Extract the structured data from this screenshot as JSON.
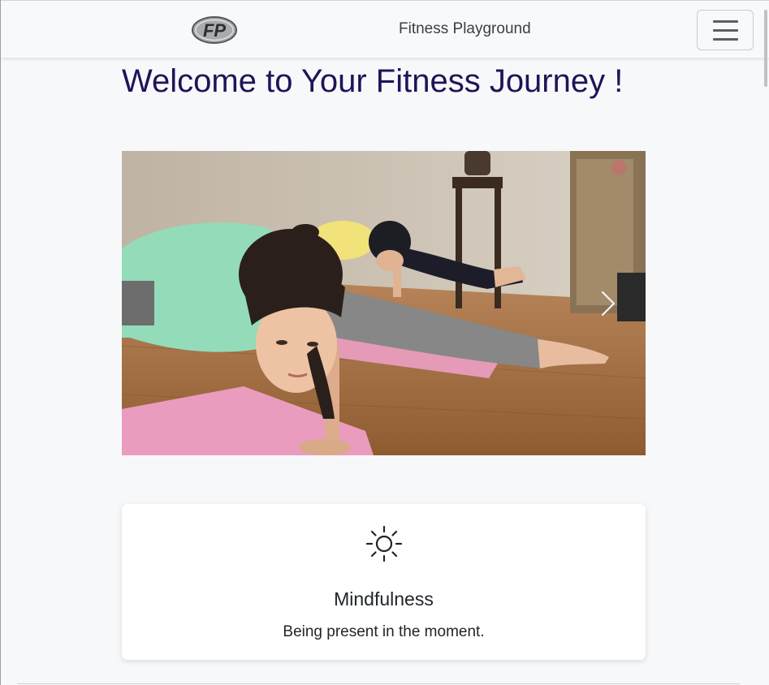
{
  "navbar": {
    "brand_logo_text": "FP",
    "brand_name": "Fitness Playground",
    "menu_icon": "hamburger-menu-icon"
  },
  "hero": {
    "title": "Welcome to Your Fitness Journey !"
  },
  "carousel": {
    "next_icon": "chevron-right-icon"
  },
  "cards": [
    {
      "icon": "sun-icon",
      "title": "Mindfulness",
      "text": "Being present in the moment."
    }
  ]
}
